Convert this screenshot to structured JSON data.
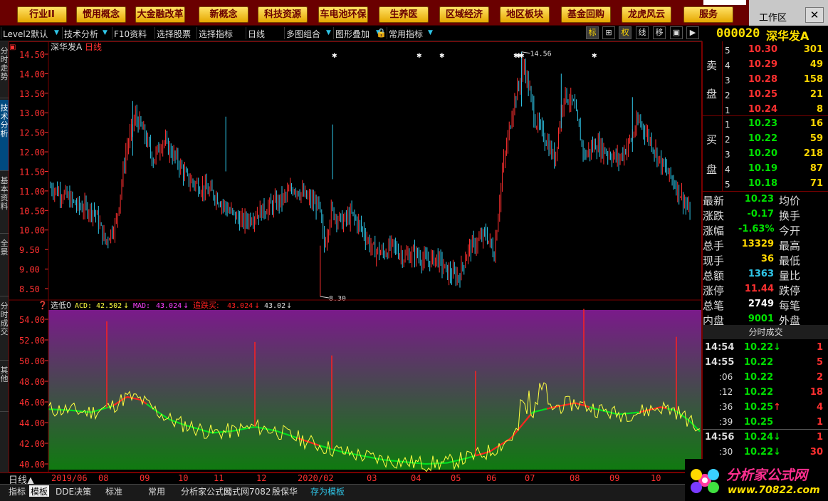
{
  "sector_buttons": [
    "行业II",
    "惯用概念",
    "大金融改革",
    "新概念",
    "科技资源",
    "车电池环保",
    "生养医",
    "区域经济",
    "地区板块",
    "基金回购",
    "龙虎风云",
    "服务"
  ],
  "workspace_label": "工作区",
  "close_symbol": "✕",
  "toolbar": {
    "items": [
      "Level2默认",
      "技术分析",
      "F10资料",
      "选择股票",
      "选择指标",
      "日线",
      "多图组合",
      "图形叠加",
      "常用指标"
    ],
    "icons": [
      "标",
      "⊞",
      "权",
      "线",
      "移",
      "▣",
      "▶"
    ]
  },
  "stock": {
    "code": "000020",
    "name": "深华发A"
  },
  "left_tabs": [
    "分时走势",
    "技术分析",
    "基本资料",
    "全景",
    "分时成交",
    "其他"
  ],
  "main_chart": {
    "title_name": "深华发A",
    "title_period": "日线",
    "price_ticks": [
      "14.50",
      "14.00",
      "13.50",
      "13.00",
      "12.50",
      "12.00",
      "11.50",
      "11.00",
      "10.50",
      "10.00",
      "9.50",
      "9.00",
      "8.50"
    ],
    "high_label": "14.56",
    "low_label": "8.30"
  },
  "indicator": {
    "name": "选低0",
    "acd_label": "ACD:",
    "acd_value": "42.502",
    "mad_label": "MAD:",
    "mad_value": "43.024",
    "buy_label": "追跌买:",
    "buy_value": "43.024",
    "last_value": "43.02",
    "down_arrow": "↓",
    "ticks": [
      "54.00",
      "52.00",
      "50.00",
      "48.00",
      "46.00",
      "44.00",
      "42.00",
      "40.00"
    ]
  },
  "dates": [
    "2019/06",
    "08",
    "09",
    "10",
    "11",
    "12",
    "2020/02",
    "03",
    "04",
    "05",
    "06",
    "07",
    "08",
    "09",
    "10"
  ],
  "period_label": "日线▲",
  "order_book": {
    "sell_label": [
      "卖",
      "盘"
    ],
    "buy_label": [
      "买",
      "盘"
    ],
    "sell": [
      {
        "level": "5",
        "price": "10.30",
        "vol": "301"
      },
      {
        "level": "4",
        "price": "10.29",
        "vol": "49"
      },
      {
        "level": "3",
        "price": "10.28",
        "vol": "158"
      },
      {
        "level": "2",
        "price": "10.25",
        "vol": "21"
      },
      {
        "level": "1",
        "price": "10.24",
        "vol": "8"
      }
    ],
    "buy": [
      {
        "level": "1",
        "price": "10.23",
        "vol": "16"
      },
      {
        "level": "2",
        "price": "10.22",
        "vol": "59"
      },
      {
        "level": "3",
        "price": "10.20",
        "vol": "218"
      },
      {
        "level": "4",
        "price": "10.19",
        "vol": "87"
      },
      {
        "level": "5",
        "price": "10.18",
        "vol": "71"
      }
    ]
  },
  "quote": [
    {
      "label": "最新",
      "value": "10.23",
      "color": "green",
      "label2": "均价"
    },
    {
      "label": "涨跌",
      "value": "-0.17",
      "color": "green",
      "label2": "换手"
    },
    {
      "label": "涨幅",
      "value": "-1.63%",
      "color": "green",
      "label2": "今开"
    },
    {
      "label": "总手",
      "value": "13329",
      "color": "yellow",
      "label2": "最高"
    },
    {
      "label": "现手",
      "value": "36",
      "color": "yellow",
      "label2": "最低"
    },
    {
      "label": "总额",
      "value": "1363",
      "color": "cyan",
      "label2": "量比"
    },
    {
      "label": "涨停",
      "value": "11.44",
      "color": "red",
      "label2": "跌停"
    },
    {
      "label": "总笔",
      "value": "2749",
      "color": "white",
      "label2": "每笔"
    },
    {
      "label": "内盘",
      "value": "9001",
      "color": "green",
      "label2": "外盘"
    }
  ],
  "ticks_header": "分时成交",
  "ticks": [
    {
      "time": "14:54",
      "sub": false,
      "price": "10.22",
      "dir": "↓",
      "pcolor": "green",
      "vol": "1",
      "vcolor": "red"
    },
    {
      "time": "14:55",
      "sub": false,
      "price": "10.22",
      "dir": "",
      "pcolor": "green",
      "vol": "5",
      "vcolor": "red"
    },
    {
      "time": ":06",
      "sub": true,
      "price": "10.22",
      "dir": "",
      "pcolor": "green",
      "vol": "2",
      "vcolor": "red"
    },
    {
      "time": ":12",
      "sub": true,
      "price": "10.22",
      "dir": "",
      "pcolor": "green",
      "vol": "18",
      "vcolor": "red"
    },
    {
      "time": ":36",
      "sub": true,
      "price": "10.25",
      "dir": "↑",
      "pcolor": "green",
      "vol": "4",
      "vcolor": "red"
    },
    {
      "time": ":39",
      "sub": true,
      "price": "10.25",
      "dir": "",
      "pcolor": "green",
      "vol": "1",
      "vcolor": "red"
    },
    {
      "time": "14:56",
      "sub": false,
      "price": "10.24",
      "dir": "↓",
      "pcolor": "green",
      "vol": "1",
      "vcolor": "red"
    },
    {
      "time": ":30",
      "sub": true,
      "price": "10.22",
      "dir": "↓",
      "pcolor": "green",
      "vol": "30",
      "vcolor": "red"
    }
  ],
  "bottom_tabs": [
    "指标",
    "模板",
    "DDE决策",
    "标准",
    "常用",
    "分析家公式网",
    "公式网7082",
    "殷保华",
    "存为模板"
  ],
  "logo": {
    "name": "分析家公式网",
    "url": "www.70822.com"
  },
  "colors": {
    "up": "#ff3030",
    "down": "#2fc6e8",
    "acd": "#ffff40",
    "mad": "#00e020",
    "buy": "#ff2020",
    "sector_bg": "#6a0000"
  }
}
